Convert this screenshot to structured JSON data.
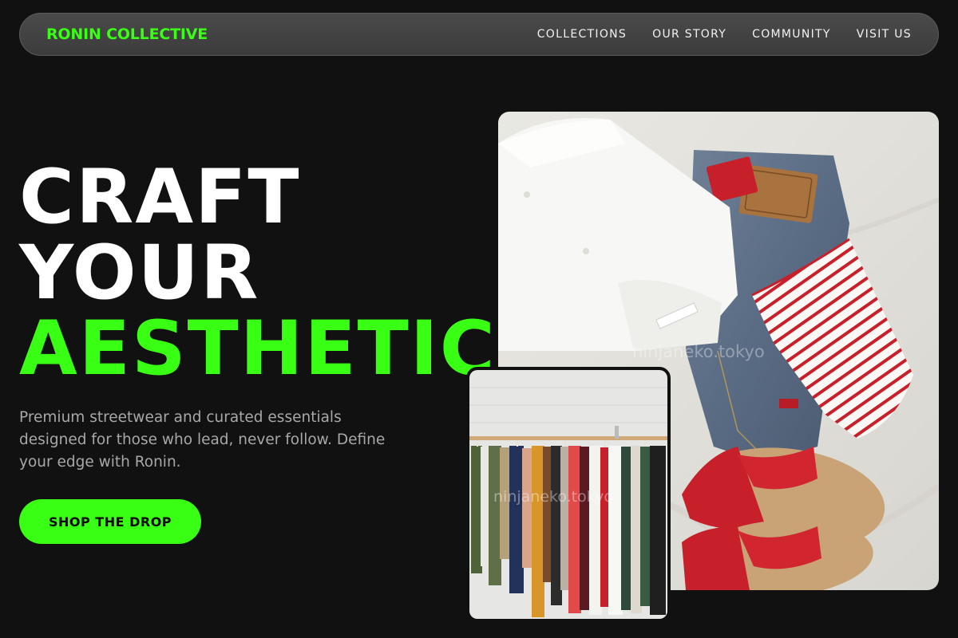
{
  "nav": {
    "brand": "RONIN COLLECTIVE",
    "links": [
      "COLLECTIONS",
      "OUR STORY",
      "COMMUNITY",
      "VISIT US"
    ]
  },
  "hero": {
    "headline_line1": "CRAFT",
    "headline_line2": "YOUR",
    "headline_line3": "AESTHETIC",
    "subtitle": "Premium streetwear and curated essentials designed for those who lead, never follow. Define your edge with Ronin.",
    "cta_label": "SHOP THE DROP"
  },
  "images": {
    "main_alt": "Flat lay of white shirt, denim jeans, striped top and red sandals",
    "main_watermark": "ninjaneko.tokyo",
    "rack_alt": "Clothing rack with colorful garments",
    "rack_watermark": "ninjaneko.tokyo"
  },
  "colors": {
    "background": "#111111",
    "accent": "#39ff14",
    "text": "#ffffff",
    "muted": "#a8a8a8"
  }
}
